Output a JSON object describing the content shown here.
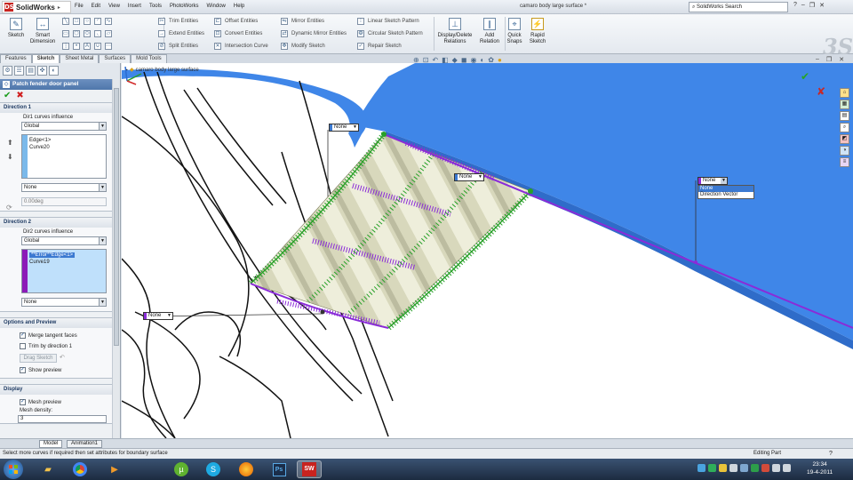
{
  "app": {
    "logo_text": "SolidWorks",
    "menu": [
      "File",
      "Edit",
      "View",
      "Insert",
      "Tools",
      "PhotoWorks",
      "Window",
      "Help"
    ],
    "document_title": "camaro body large surface *",
    "search_placeholder": "SolidWorks Search"
  },
  "ribbon": {
    "sketch_label": "Sketch",
    "smart_dimension_label": "Smart Dimension",
    "col1": [
      "Trim Entities",
      "Extend Entities",
      "Split Entities"
    ],
    "col2": [
      "Offset Entities",
      "Convert Entities",
      "Intersection Curve"
    ],
    "col3": [
      "Mirror Entities",
      "Dynamic Mirror Entities",
      "Modify Sketch"
    ],
    "col4": [
      "Linear Sketch Pattern",
      "Circular Sketch Pattern",
      "Repair Sketch"
    ],
    "display_delete_label": "Display/Delete Relations",
    "add_relation_label": "Add Relation",
    "quick_snaps_label": "Quick Snaps",
    "rapid_sketch_label": "Rapid Sketch"
  },
  "tabs": [
    "Features",
    "Sketch",
    "Sheet Metal",
    "Surfaces",
    "Mold Tools"
  ],
  "active_tab": "Sketch",
  "property_manager": {
    "title": "Patch fender door panel",
    "direction1": {
      "header": "Direction 1",
      "influence_label": "Dir1 curves influence",
      "influence_value": "Global",
      "list_items": [
        "Edge<1>",
        "Curve20"
      ],
      "tangency_value": "None",
      "angle_value": "0.00deg"
    },
    "direction2": {
      "header": "Direction 2",
      "influence_label": "Dir2 curves influence",
      "influence_value": "Global",
      "list_items": [
        "**Error**Edge<1>",
        "Curve19"
      ],
      "tangency_value": "None"
    },
    "options": {
      "header": "Options and Preview",
      "merge_tangent": "Merge tangent faces",
      "trim_by_direction": "Trim by direction 1",
      "drag_sketch": "Drag Sketch",
      "show_preview": "Show preview"
    },
    "display": {
      "header": "Display",
      "mesh_preview": "Mesh preview",
      "mesh_density_label": "Mesh density:",
      "mesh_density_value": "3"
    }
  },
  "viewport": {
    "tree_tag": "camaro body large surface",
    "callout_none_1": "None",
    "callout_none_2": "None",
    "callout_none_3": "None",
    "callout_none_4": "None",
    "dropdown_options": [
      "None",
      "Direction Vector"
    ]
  },
  "bottom_tabs": [
    "Model",
    "Animation1"
  ],
  "status": {
    "message": "Select more curves if required then set attributes for boundary surface",
    "mode": "Editing Part",
    "help": "?"
  },
  "taskbar": {
    "time": "23:34",
    "date": "19-4-2011"
  },
  "colors": {
    "surface_blue": "#3f86e8",
    "mesh_green": "#28a028",
    "mesh_purple": "#8a2bd8",
    "selection_blue": "#3b79d1"
  }
}
